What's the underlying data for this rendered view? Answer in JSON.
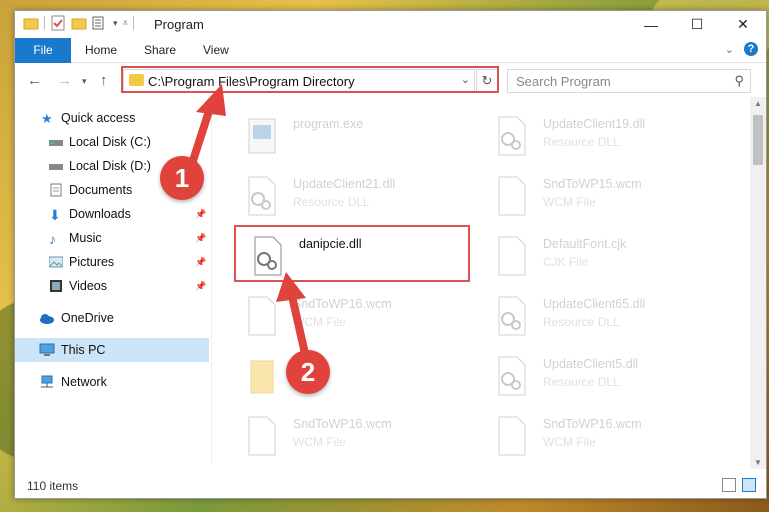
{
  "window": {
    "title": "Program",
    "controls": [
      "minimize",
      "maximize",
      "close"
    ]
  },
  "ribbon": {
    "tabs": [
      "File",
      "Home",
      "Share",
      "View"
    ],
    "help_label": "?"
  },
  "address_bar": {
    "path": "C:\\Program Files\\Program Directory"
  },
  "search": {
    "placeholder": "Search Program"
  },
  "sidebar": {
    "items": [
      {
        "label": "Quick access",
        "icon": "star-icon",
        "pinned": false
      },
      {
        "label": "Local Disk (C:)",
        "icon": "drive-icon",
        "pinned": false
      },
      {
        "label": "Local Disk (D:)",
        "icon": "drive-icon",
        "pinned": false
      },
      {
        "label": "Documents",
        "icon": "documents-icon",
        "pinned": false
      },
      {
        "label": "Downloads",
        "icon": "download-icon",
        "pinned": true
      },
      {
        "label": "Music",
        "icon": "music-icon",
        "pinned": true
      },
      {
        "label": "Pictures",
        "icon": "pictures-icon",
        "pinned": true
      },
      {
        "label": "Videos",
        "icon": "videos-icon",
        "pinned": true
      },
      {
        "label": "OneDrive",
        "icon": "cloud-icon",
        "pinned": false
      },
      {
        "label": "This PC",
        "icon": "computer-icon",
        "pinned": false,
        "selected": true
      },
      {
        "label": "Network",
        "icon": "network-icon",
        "pinned": false
      }
    ]
  },
  "files": [
    {
      "name": "program.exe",
      "type": "",
      "icon": "exe-icon"
    },
    {
      "name": "UpdateClient19.dll",
      "type": "Resource DLL",
      "icon": "dll-icon"
    },
    {
      "name": "UpdateClient21.dll",
      "type": "Resource DLL",
      "icon": "dll-icon"
    },
    {
      "name": "SndToWP15.wcm",
      "type": "WCM File",
      "icon": "blank-file-icon"
    },
    {
      "name": "danipcie.dll",
      "type": "",
      "icon": "dll-icon",
      "selected": true
    },
    {
      "name": "DefaultFont.cjk",
      "type": "CJK File",
      "icon": "blank-file-icon"
    },
    {
      "name": "SndToWP16.wcm",
      "type": "WCM File",
      "icon": "blank-file-icon"
    },
    {
      "name": "UpdateClient65.dll",
      "type": "Resource DLL",
      "icon": "dll-icon"
    },
    {
      "name": "",
      "type": "",
      "icon": "folder-icon"
    },
    {
      "name": "UpdateClient5.dll",
      "type": "Resource DLL",
      "icon": "dll-icon"
    },
    {
      "name": "SndToWP16.wcm",
      "type": "WCM File",
      "icon": "blank-file-icon"
    },
    {
      "name": "SndToWP16.wcm",
      "type": "WCM File",
      "icon": "blank-file-icon"
    }
  ],
  "status": {
    "item_count": "110 items"
  },
  "callouts": [
    "1",
    "2"
  ],
  "colors": {
    "accent": "#1979ca",
    "highlight": "#d9534f",
    "callout": "#e0423c"
  }
}
